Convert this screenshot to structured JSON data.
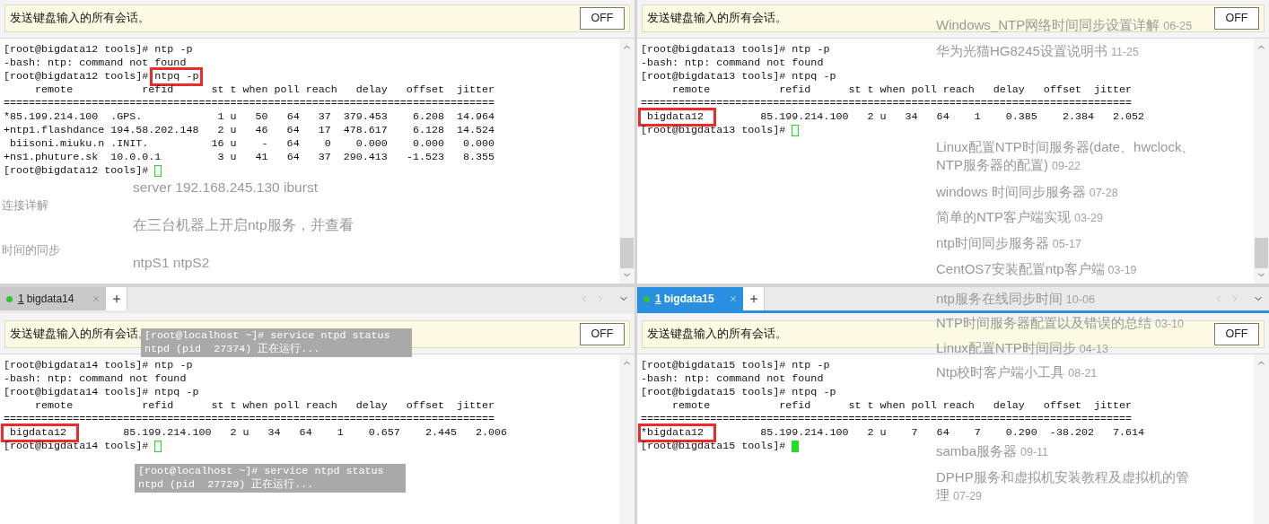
{
  "panes": [
    {
      "broadcast": {
        "text": "发送键盘输入的所有会话。",
        "button": "OFF"
      },
      "terminal": {
        "cursor_active": false,
        "lines": [
          {
            "kind": "command",
            "prompt": "[root@bigdata12 tools]# ",
            "command": "ntp -p",
            "highlighted": false
          },
          {
            "kind": "output",
            "text": "-bash: ntp: command not found"
          },
          {
            "kind": "command",
            "prompt": "[root@bigdata12 tools]# ",
            "command": "ntpq -p",
            "highlighted": true
          },
          {
            "kind": "output",
            "text": "     remote           refid      st t when poll reach   delay   offset  jitter"
          },
          {
            "kind": "output",
            "text": "=============================================================================="
          },
          {
            "kind": "peer",
            "remote": "*85.199.214.100",
            "rest": "  .GPS.            1 u   50   64   37  379.453    6.208  14.964",
            "highlighted": false
          },
          {
            "kind": "peer",
            "remote": "+ntp1.flashdance",
            "rest": " 194.58.202.148   2 u   46   64   17  478.617    6.128  14.524",
            "highlighted": false
          },
          {
            "kind": "peer",
            "remote": " biisoni.miuku.n",
            "rest": " .INIT.          16 u    -   64    0    0.000    0.000   0.000",
            "highlighted": false
          },
          {
            "kind": "peer",
            "remote": "+ns1.phuture.sk",
            "rest": "  10.0.0.1         3 u   41   64   37  290.413   -1.523   8.355",
            "highlighted": false
          },
          {
            "kind": "prompt",
            "prompt": "[root@bigdata12 tools]# "
          }
        ]
      }
    },
    {
      "broadcast": {
        "text": "发送键盘输入的所有会话。",
        "button": "OFF"
      },
      "terminal": {
        "cursor_active": false,
        "lines": [
          {
            "kind": "command",
            "prompt": "[root@bigdata13 tools]# ",
            "command": "ntp -p",
            "highlighted": false
          },
          {
            "kind": "output",
            "text": "-bash: ntp: command not found"
          },
          {
            "kind": "command",
            "prompt": "[root@bigdata13 tools]# ",
            "command": "ntpq -p",
            "highlighted": false
          },
          {
            "kind": "output",
            "text": "     remote           refid      st t when poll reach   delay   offset  jitter"
          },
          {
            "kind": "output",
            "text": "=============================================================================="
          },
          {
            "kind": "peer",
            "remote": " bigdata12",
            "rest": "       85.199.214.100   2 u   34   64    1    0.385    2.384   2.052",
            "highlighted": true
          },
          {
            "kind": "prompt",
            "prompt": "[root@bigdata13 tools]# "
          }
        ]
      }
    },
    {
      "tab": {
        "number": "1",
        "label": "bigdata14",
        "selected": false
      },
      "broadcast": {
        "text": "发送键盘输入的所有会话。",
        "button": "OFF"
      },
      "terminal": {
        "cursor_active": false,
        "lines": [
          {
            "kind": "command",
            "prompt": "[root@bigdata14 tools]# ",
            "command": "ntp -p",
            "highlighted": false
          },
          {
            "kind": "output",
            "text": "-bash: ntp: command not found"
          },
          {
            "kind": "command",
            "prompt": "[root@bigdata14 tools]# ",
            "command": "ntpq -p",
            "highlighted": false
          },
          {
            "kind": "output",
            "text": "     remote           refid      st t when poll reach   delay   offset  jitter"
          },
          {
            "kind": "output",
            "text": "=============================================================================="
          },
          {
            "kind": "peer",
            "remote": " bigdata12",
            "rest": "       85.199.214.100   2 u   34   64    1    0.657    2.445   2.006",
            "highlighted": true
          },
          {
            "kind": "prompt",
            "prompt": "[root@bigdata14 tools]# "
          }
        ]
      }
    },
    {
      "tab": {
        "number": "1",
        "label": "bigdata15",
        "selected": true
      },
      "broadcast": {
        "text": "发送键盘输入的所有会话。",
        "button": "OFF"
      },
      "terminal": {
        "cursor_active": true,
        "lines": [
          {
            "kind": "command",
            "prompt": "[root@bigdata15 tools]# ",
            "command": "ntp -p",
            "highlighted": false
          },
          {
            "kind": "output",
            "text": "-bash: ntp: command not found"
          },
          {
            "kind": "command",
            "prompt": "[root@bigdata15 tools]# ",
            "command": "ntpq -p",
            "highlighted": false
          },
          {
            "kind": "output",
            "text": "     remote           refid      st t when poll reach   delay   offset  jitter"
          },
          {
            "kind": "output",
            "text": "=============================================================================="
          },
          {
            "kind": "peer",
            "remote": "*bigdata12",
            "rest": "       85.199.214.100   2 u    7   64    7    0.290  -38.202   7.614",
            "highlighted": true
          },
          {
            "kind": "prompt",
            "prompt": "[root@bigdata15 tools]# "
          }
        ]
      }
    }
  ],
  "background_page": {
    "left_texts": [
      "server 192.168.245.130 iburst",
      "在三台机器上开启ntp服务，并查看",
      "ntpS1 ntpS2"
    ],
    "sidebar_texts": [
      "连接详解",
      "时间的同步"
    ],
    "snippets": [
      [
        "[root@localhost ~]# service ntpd status",
        "ntpd (pid  27374) 正在运行..."
      ],
      [
        "[root@localhost ~]# service ntpd status",
        "ntpd (pid  27729) 正在运行..."
      ]
    ],
    "related_articles": [
      {
        "title": "Windows_NTP网络时间同步设置详解",
        "date": "06-25"
      },
      {
        "title": "华为光猫HG8245设置说明书",
        "date": "11-25"
      },
      {
        "title": "Linux配置NTP时间服务器(date、hwclock、NTP服务器的配置)",
        "date": "09-22"
      },
      {
        "title": "windows 时间同步服务器",
        "date": "07-28"
      },
      {
        "title": "简单的NTP客户端实现",
        "date": "03-29"
      },
      {
        "title": "ntp时间同步服务器",
        "date": "05-17"
      },
      {
        "title": "CentOS7安装配置ntp客户端",
        "date": "03-19"
      },
      {
        "title": "ntp服务在线同步时间",
        "date": "10-06"
      },
      {
        "title": "NTP时间服务器配置以及错误的总结",
        "date": "03-10"
      },
      {
        "title": "Linux配置NTP时间同步",
        "date": "04-13"
      },
      {
        "title": "Ntp校时客户端小工具",
        "date": "08-21"
      },
      {
        "title": "samba服务器",
        "date": "09-11"
      },
      {
        "title": "DPHP服务和虚拟机安装教程及虚拟机的管理",
        "date": "07-29"
      }
    ]
  }
}
